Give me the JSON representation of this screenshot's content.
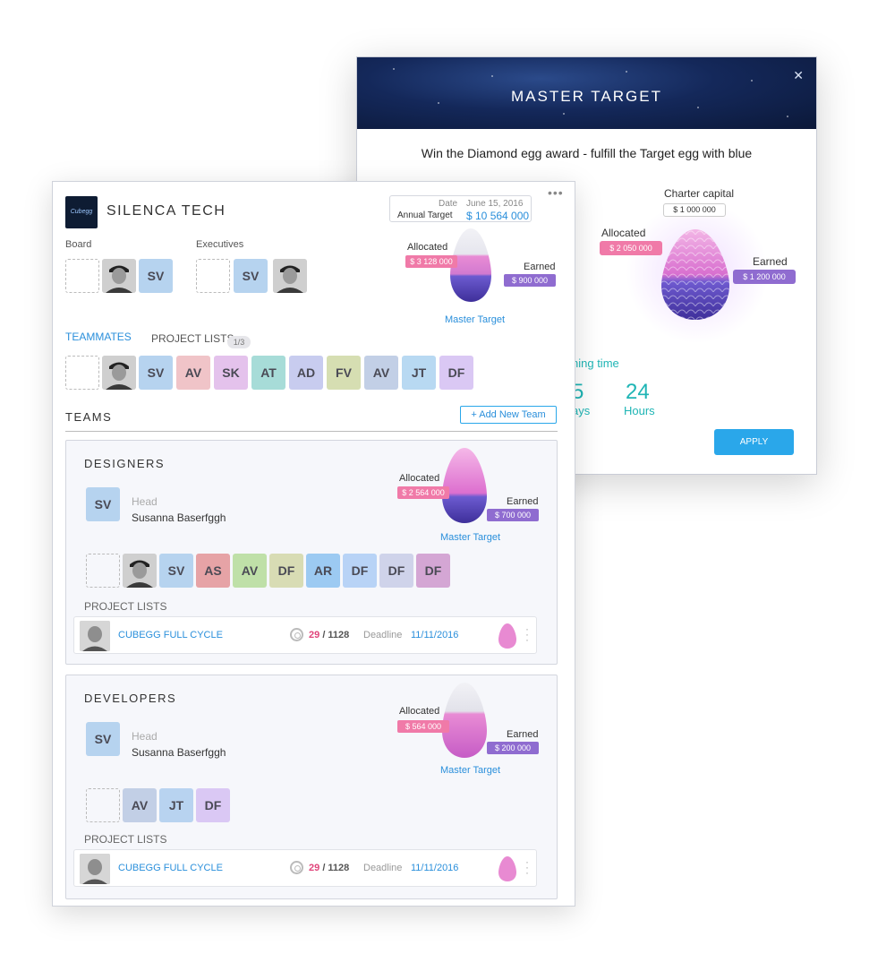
{
  "modal": {
    "title": "MASTER TARGET",
    "close_icon": "close-icon",
    "subtitle": "Win the Diamond egg award - fulfill  the Target egg with blue",
    "charter_capital_label": "Charter capital",
    "charter_capital_value": "$ 1 000 000",
    "allocated_label": "Allocated",
    "allocated_value": "$ 2 050 000",
    "earned_label": "Earned",
    "earned_value": "$ 1 200 000",
    "remaining_label": "ning time",
    "days_value": "5",
    "days_label": "ays",
    "hours_value": "24",
    "hours_label": "Hours",
    "apply_label": "APPLY"
  },
  "company": {
    "logo_text": "Cubegg",
    "name": "SILENCA TECH",
    "more_icon": "more-dots-icon",
    "date_label": "Date",
    "date_value": "June 15, 2016",
    "annual_target_label": "Annual  Target",
    "annual_target_value": "$ 10 564 000",
    "board_label": "Board",
    "executives_label": "Executives",
    "board_initials": [
      "SV"
    ],
    "executives_initials": [
      "SV"
    ],
    "egg": {
      "allocated_label": "Allocated",
      "allocated_value": "$ 3 128 000",
      "earned_label": "Earned",
      "earned_value": "$ 900 000",
      "master_target_label": "Master Target"
    }
  },
  "tabs": {
    "teammates": "TEAMMATES",
    "project_lists": "PROJECT LISTS",
    "project_lists_badge": "1/3"
  },
  "teammates": [
    {
      "initials": "SV",
      "color": "#b6d3ef"
    },
    {
      "initials": "AV",
      "color": "#f0c4c8"
    },
    {
      "initials": "SK",
      "color": "#e4c2ec"
    },
    {
      "initials": "AT",
      "color": "#a7dcd8"
    },
    {
      "initials": "AD",
      "color": "#c8ccef"
    },
    {
      "initials": "FV",
      "color": "#d6deb2"
    },
    {
      "initials": "AV",
      "color": "#c2cfe6"
    },
    {
      "initials": "JT",
      "color": "#b8d9f2"
    },
    {
      "initials": "DF",
      "color": "#dac8f4"
    }
  ],
  "teams_label": "TEAMS",
  "add_team_label": "+ Add New Team",
  "teams": [
    {
      "name": "DESIGNERS",
      "head_initials": "SV",
      "head_label": "Head",
      "head_name": "Susanna Baserfggh",
      "egg": {
        "allocated_label": "Allocated",
        "allocated_value": "$ 2 564 000",
        "earned_label": "Earned",
        "earned_value": "$ 700 000",
        "master_target_label": "Master Target"
      },
      "members": [
        {
          "initials": "SV",
          "color": "#b6d3ef"
        },
        {
          "initials": "AS",
          "color": "#e6a3a6"
        },
        {
          "initials": "AV",
          "color": "#bfe0a8"
        },
        {
          "initials": "DF",
          "color": "#d8dcb4"
        },
        {
          "initials": "AR",
          "color": "#9ccaf2"
        },
        {
          "initials": "DF",
          "color": "#b8d3f6"
        },
        {
          "initials": "DF",
          "color": "#cfd3ea"
        },
        {
          "initials": "DF",
          "color": "#d4a6d4"
        }
      ],
      "project_lists_label": "PROJECT LISTS",
      "project": {
        "name": "CUBEGG FULL CYCLE",
        "count_done": "29",
        "count_total": "/ 1128",
        "deadline_label": "Deadline",
        "deadline_value": "11/11/2016"
      }
    },
    {
      "name": "DEVELOPERS",
      "head_initials": "SV",
      "head_label": "Head",
      "head_name": "Susanna Baserfggh",
      "egg": {
        "allocated_label": "Allocated",
        "allocated_value": "$  564 000",
        "earned_label": "Earned",
        "earned_value": "$ 200 000",
        "master_target_label": "Master Target"
      },
      "members": [
        {
          "initials": "AV",
          "color": "#c2cfe6"
        },
        {
          "initials": "JT",
          "color": "#b8d3f0"
        },
        {
          "initials": "DF",
          "color": "#dac8f4"
        }
      ],
      "project_lists_label": "PROJECT LISTS",
      "project": {
        "name": "CUBEGG FULL CYCLE",
        "count_done": "29",
        "count_total": "/ 1128",
        "deadline_label": "Deadline",
        "deadline_value": "11/11/2016"
      }
    }
  ]
}
